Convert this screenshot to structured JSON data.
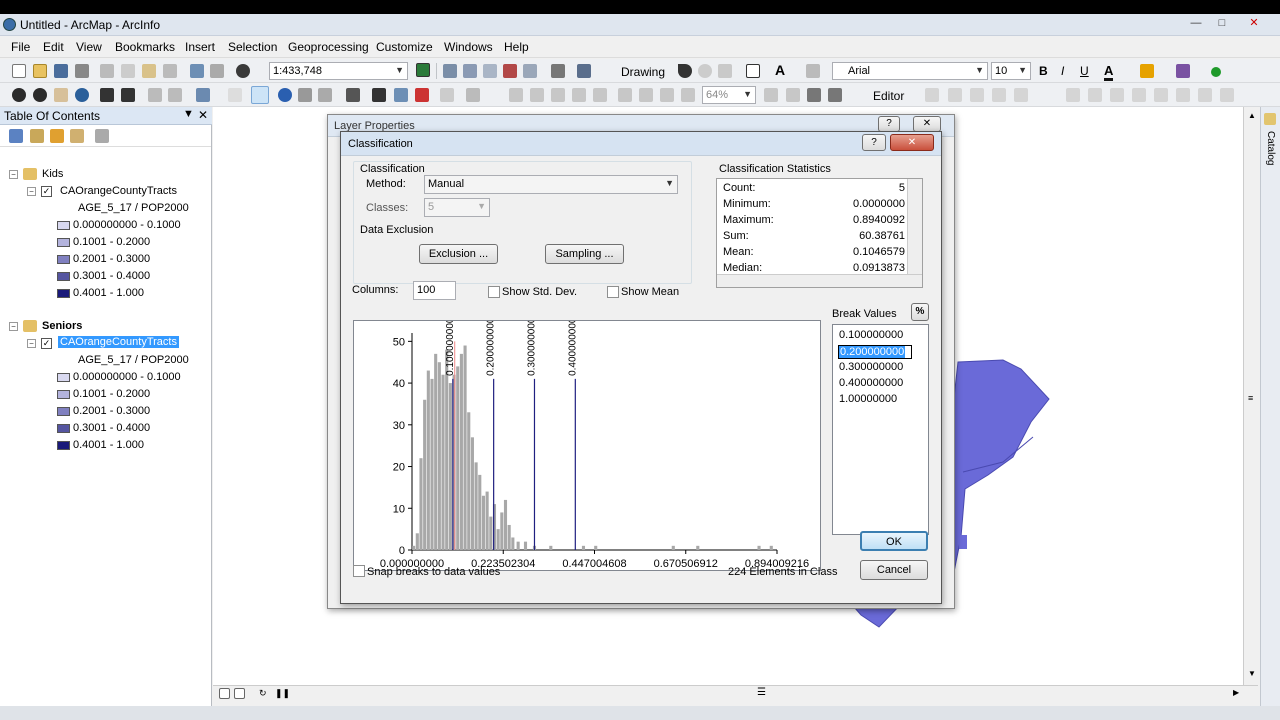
{
  "app": {
    "title": "Untitled - ArcMap - ArcInfo"
  },
  "menu": [
    "File",
    "Edit",
    "View",
    "Bookmarks",
    "Insert",
    "Selection",
    "Geoprocessing",
    "Customize",
    "Windows",
    "Help"
  ],
  "toolbar": {
    "scale": "1:433,748",
    "drawing_label": "Drawing",
    "font_name": "Arial",
    "font_size": "10",
    "zoom": "64%",
    "editor_label": "Editor"
  },
  "toc": {
    "title": "Table Of Contents",
    "groups": [
      {
        "name": "Kids",
        "layer": "CAOrangeCountyTracts",
        "field": "AGE_5_17 / POP2000",
        "classes": [
          "0.000000000 - 0.1000",
          "0.1001 - 0.2000",
          "0.2001 - 0.3000",
          "0.3001 - 0.4000",
          "0.4001 - 1.000"
        ]
      },
      {
        "name": "Seniors",
        "layer": "CAOrangeCountyTracts",
        "field": "AGE_5_17 / POP2000",
        "classes": [
          "0.000000000 - 0.1000",
          "0.1001 - 0.2000",
          "0.2001 - 0.3000",
          "0.3001 - 0.4000",
          "0.4001 - 1.000"
        ]
      }
    ],
    "class_colors": [
      "#d9d9f0",
      "#b3b3dd",
      "#8080c0",
      "#5555a0",
      "#1a1a7a"
    ]
  },
  "catalog_tab": "Catalog",
  "layer_props": {
    "title": "Layer Properties"
  },
  "classification": {
    "title": "Classification",
    "section_label": "Classification",
    "method_label": "Method:",
    "method": "Manual",
    "classes_label": "Classes:",
    "classes": "5",
    "exclusion_label": "Data Exclusion",
    "exclusion_btn": "Exclusion ...",
    "sampling_btn": "Sampling ...",
    "stats_label": "Classification Statistics",
    "stats": [
      {
        "k": "Count:",
        "v": "5"
      },
      {
        "k": "Minimum:",
        "v": "0.0000000"
      },
      {
        "k": "Maximum:",
        "v": "0.8940092"
      },
      {
        "k": "Sum:",
        "v": "60.38761"
      },
      {
        "k": "Mean:",
        "v": "0.1046579"
      },
      {
        "k": "Median:",
        "v": "0.0913873"
      }
    ],
    "columns_label": "Columns:",
    "columns": "100",
    "show_std": "Show Std. Dev.",
    "show_mean": "Show Mean",
    "break_values_label": "Break Values",
    "pct_btn": "%",
    "break_values": [
      "0.100000000",
      "0.200000000",
      "0.300000000",
      "0.400000000",
      "1.00000000"
    ],
    "snap_label": "Snap breaks to data values",
    "elements_text": "224 Elements in Class",
    "ok": "OK",
    "cancel": "Cancel"
  },
  "chart_data": {
    "type": "bar",
    "xlim": [
      0,
      0.894009216
    ],
    "ylim": [
      0,
      52
    ],
    "yticks": [
      "0",
      "10",
      "20",
      "30",
      "40",
      "50"
    ],
    "xticks": [
      "0.000000000",
      "0.223502304",
      "0.447004608",
      "0.670506912",
      "0.894009216"
    ],
    "breaks": [
      0.1,
      0.2,
      0.3,
      0.4
    ],
    "break_labels": [
      "0.100000000",
      "0.200000000",
      "0.300000000",
      "0.400000000"
    ],
    "bin_centers": [
      0.004,
      0.013,
      0.022,
      0.031,
      0.04,
      0.049,
      0.058,
      0.067,
      0.076,
      0.085,
      0.094,
      0.103,
      0.112,
      0.121,
      0.13,
      0.139,
      0.148,
      0.157,
      0.166,
      0.175,
      0.184,
      0.193,
      0.202,
      0.211,
      0.22,
      0.229,
      0.238,
      0.247,
      0.26,
      0.278,
      0.3,
      0.34,
      0.42,
      0.45,
      0.64,
      0.7,
      0.85,
      0.88
    ],
    "counts": [
      1,
      4,
      22,
      36,
      43,
      41,
      47,
      45,
      42,
      48,
      40,
      42,
      44,
      47,
      49,
      33,
      27,
      21,
      18,
      13,
      14,
      8,
      11,
      5,
      9,
      12,
      6,
      3,
      2,
      2,
      1,
      1,
      1,
      1,
      1,
      1,
      1,
      1
    ]
  }
}
